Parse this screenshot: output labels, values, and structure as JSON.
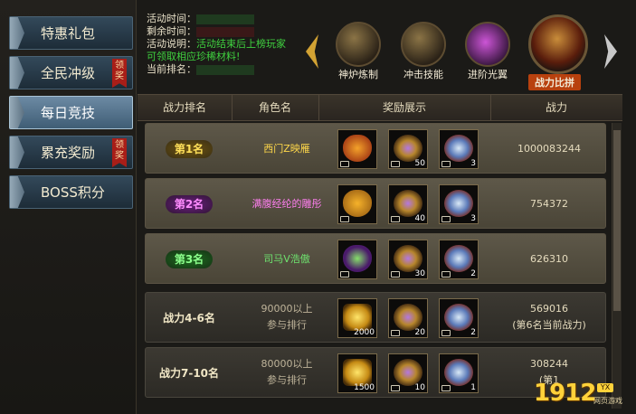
{
  "nav": [
    {
      "label": "特惠礼包",
      "badge": ""
    },
    {
      "label": "全民冲级",
      "badge": "领奖"
    },
    {
      "label": "每日竞技",
      "badge": ""
    },
    {
      "label": "累充奖励",
      "badge": "领奖"
    },
    {
      "label": "BOSS积分",
      "badge": ""
    }
  ],
  "nav_active_index": 2,
  "info": {
    "time_label": "活动时间：",
    "remain_label": "剩余时间：",
    "desc_label": "活动说明：",
    "desc_line1": "活动结束后上榜玩家",
    "desc_line2": "可领取相应珍稀材料!",
    "rank_label": "当前排名："
  },
  "tabs": [
    {
      "label": "神炉炼制"
    },
    {
      "label": "冲击技能"
    },
    {
      "label": "进阶光翼"
    },
    {
      "label": "战力比拼"
    }
  ],
  "table": {
    "headers": [
      "战力排名",
      "角色名",
      "奖励展示",
      "战力"
    ],
    "rows": [
      {
        "rank": "第1名",
        "name": "西门Z映雁",
        "counts": [
          "",
          "50",
          "3"
        ],
        "power": "1000083244",
        "power_note": ""
      },
      {
        "rank": "第2名",
        "name": "满腹经纶的雕彤",
        "counts": [
          "",
          "40",
          "3"
        ],
        "power": "754372",
        "power_note": ""
      },
      {
        "rank": "第3名",
        "name": "司马V浩傲",
        "counts": [
          "",
          "30",
          "2"
        ],
        "power": "626310",
        "power_note": ""
      },
      {
        "rank": "战力4-6名",
        "name_line1": "90000以上",
        "name_line2": "参与排行",
        "counts": [
          "2000",
          "20",
          "2"
        ],
        "power": "569016",
        "power_note": "(第6名当前战力)"
      },
      {
        "rank": "战力7-10名",
        "name_line1": "80000以上",
        "name_line2": "参与排行",
        "counts": [
          "1500",
          "10",
          "1"
        ],
        "power": "308244",
        "power_note": "(第1"
      }
    ]
  },
  "colors": {
    "rank1": "#ffe05a",
    "rank2": "#ff8cff",
    "rank3": "#8dff8d",
    "green_text": "#3fd13f"
  },
  "logo": {
    "num": "1912",
    "badge": "YX",
    "sub": "网页游戏"
  }
}
